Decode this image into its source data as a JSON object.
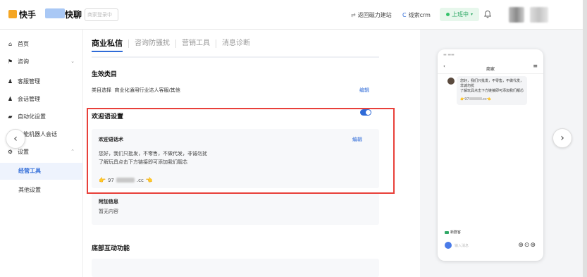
{
  "header": {
    "app_name": "快手",
    "app_name2": "快聊",
    "account_tag": "商家登录中",
    "link_back": "返回磁力建站",
    "link_crm": "线索crm",
    "status": "上班中"
  },
  "sidebar": {
    "items": [
      {
        "label": "首页",
        "icon": "home-icon"
      },
      {
        "label": "咨询",
        "icon": "flag-icon"
      },
      {
        "label": "客服管理",
        "icon": "user-icon"
      },
      {
        "label": "会话管理",
        "icon": "chat-icon"
      },
      {
        "label": "自动化设置",
        "icon": "auto-icon"
      },
      {
        "label": "智能机器人会话",
        "icon": "robot-icon"
      },
      {
        "label": "设置",
        "icon": "gear-icon"
      }
    ],
    "sub_items": [
      {
        "label": "经营工具",
        "active": true
      },
      {
        "label": "其他设置",
        "active": false
      }
    ]
  },
  "main": {
    "tabs": [
      "商业私信",
      "咨询防骚扰",
      "营销工具",
      "消息诊断"
    ],
    "sections": {
      "effective_category_title": "生效类目",
      "category_label": "类目选择",
      "category_value": "商业化通用行业达人客服/其他",
      "category_edit": "编辑",
      "welcome_title": "欢迎语设置",
      "welcome_card_title": "欢迎语话术",
      "welcome_edit": "编辑",
      "welcome_line1": "您好，我们只批发，不零售，不做代发，非诚勿扰",
      "welcome_line2": "了解玩具点击下方链接即可添加我们靓芯",
      "welcome_link_text": "97",
      "welcome_link_suffix": ".cc",
      "extra_title": "附加信息",
      "extra_value": "暂无内容",
      "bottom_title": "底部互动功能"
    }
  },
  "preview": {
    "header_title": "商家",
    "bubble_line1": "您好，我们只批发，不零售，不做代发，非诚勿扰",
    "bubble_line2": "了解玩具点击下方链接即可添加我们靓芯",
    "bubble_link_text": "97",
    "bubble_link_suffix": ".cc",
    "follow_tag": "新群客",
    "input_placeholder": "输入消息"
  },
  "colors": {
    "accent": "#2f6bd8",
    "status_green": "#2fa866",
    "highlight_red": "#e8403a"
  }
}
